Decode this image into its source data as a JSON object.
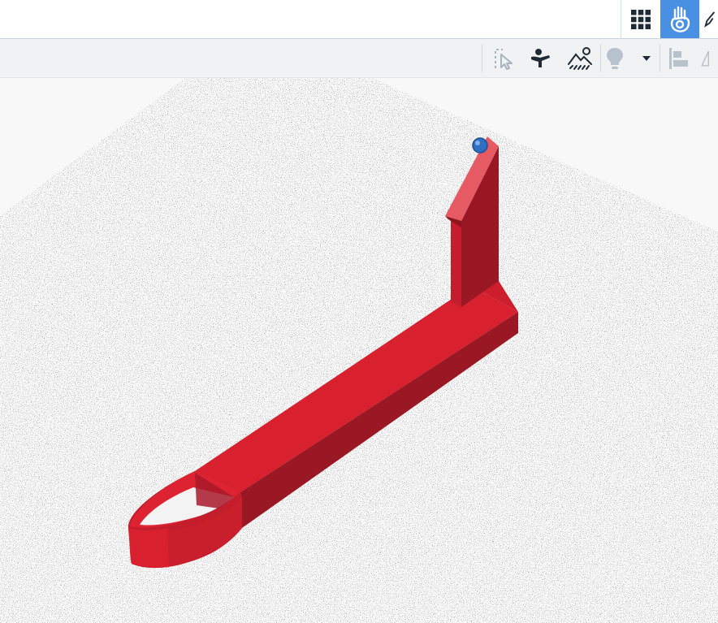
{
  "header": {
    "icons": {
      "grid": "grid-view-icon",
      "hand": "hand-interaction-icon",
      "more": "wrench-icon"
    }
  },
  "toolbar": {
    "icons": [
      "snap-select-icon",
      "user-pose-icon",
      "scene-lighting-icon",
      "lightbulb-icon",
      "dropdown-arrow-icon",
      "align-left-icon",
      "mirror-icon"
    ]
  },
  "colors": {
    "accent": "#4a90e2",
    "model_top": "#d8202f",
    "model_side": "#991824",
    "model_highlight": "#e65a64",
    "marker": "#2f6fc2"
  },
  "viewport": {
    "object": "red-3d-model",
    "ground": "noise-grid-plane"
  }
}
